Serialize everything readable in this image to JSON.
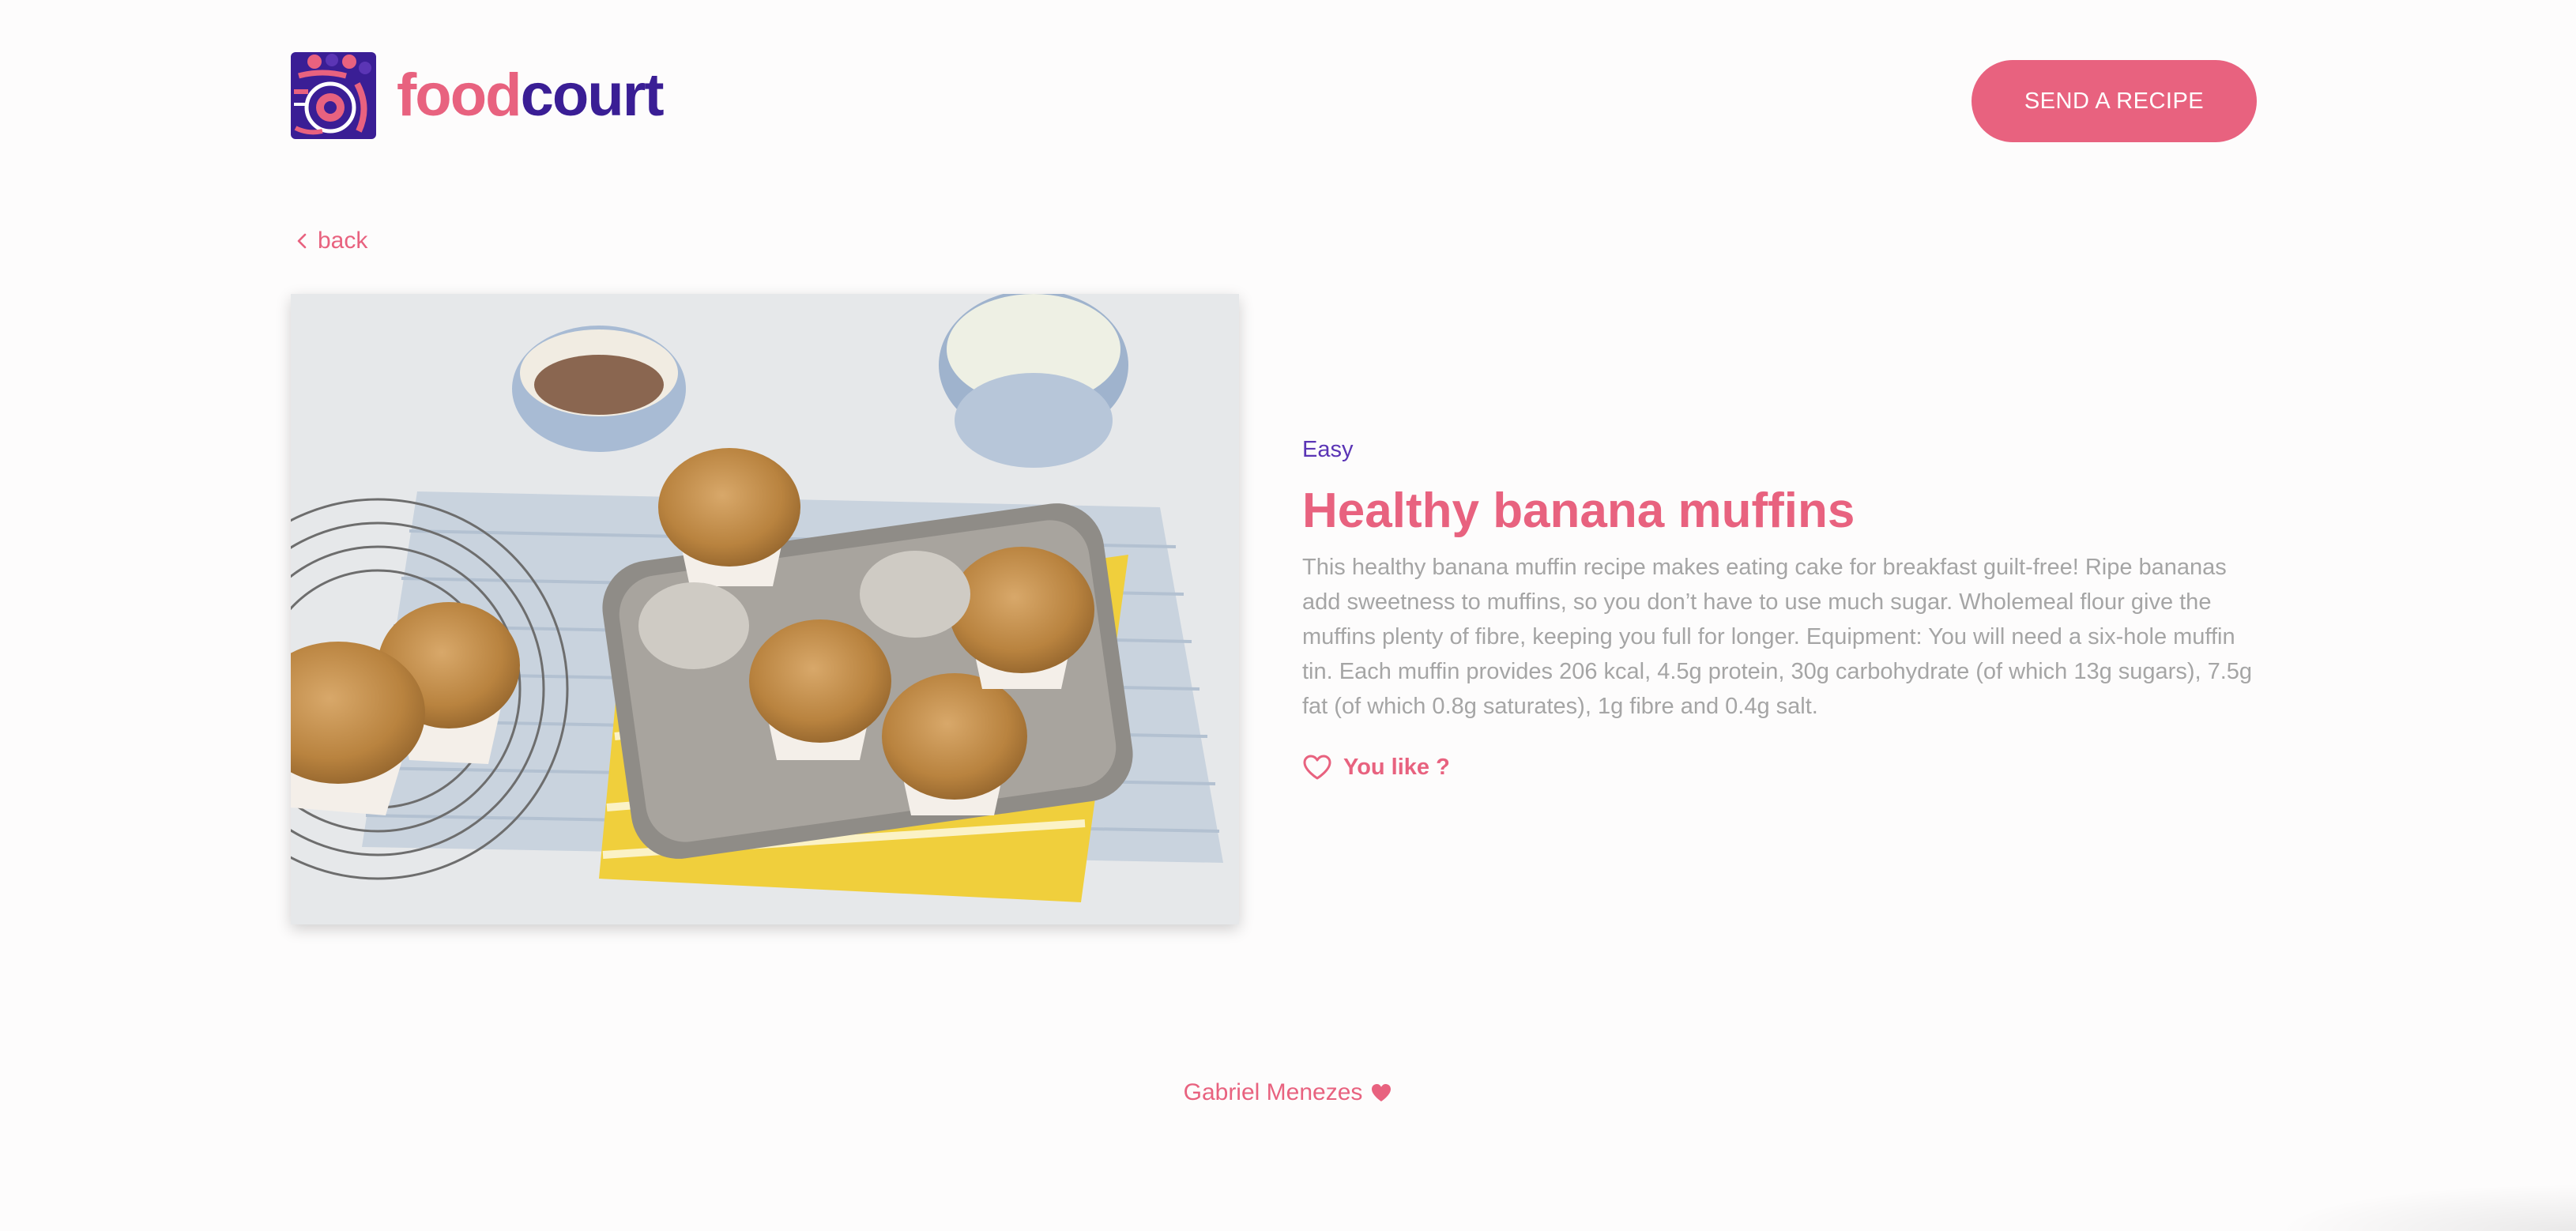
{
  "header": {
    "logo_food": "food",
    "logo_court": "court",
    "send_button_label": "SEND A RECIPE"
  },
  "nav": {
    "back_label": "back",
    "back_icon": "chevron-left-icon"
  },
  "recipe": {
    "image_subject": "banana muffins in a muffin tin with cups",
    "difficulty": "Easy",
    "title": "Healthy banana muffins",
    "description": "This healthy banana muffin recipe makes eating cake for breakfast guilt-free! Ripe bananas add sweetness to muffins, so you don’t have to use much sugar. Wholemeal flour give the muffins plenty of fibre, keeping you full for longer. Equipment: You will need a six-hole muffin tin. Each muffin provides 206 kcal, 4.5g protein, 30g carbohydrate (of which 13g sugars), 7.5g fat (of which 0.8g saturates), 1g fibre and 0.4g salt.",
    "like_label": "You like ?",
    "like_icon": "heart-outline-icon"
  },
  "footer": {
    "author": "Gabriel Menezes",
    "heart_icon": "heart-filled-icon"
  },
  "colors": {
    "brand_pink": "#e8627f",
    "brand_purple": "#3a1e95",
    "difficulty_purple": "#5b35b5",
    "text_gray": "#a5a5a5",
    "background": "#fdfcfc"
  }
}
